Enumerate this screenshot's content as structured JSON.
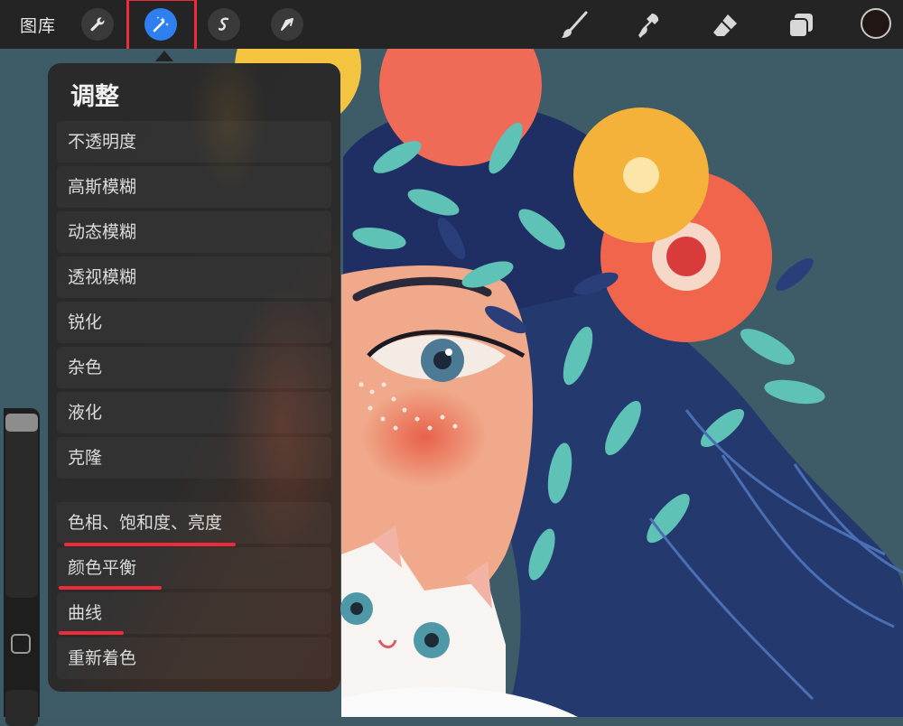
{
  "toolbar": {
    "gallery_label": "图库",
    "left_tools": [
      "wrench-icon",
      "magic-wand-icon",
      "selection-icon",
      "transform-arrow-icon"
    ],
    "right_tools": [
      "brush-icon",
      "smudge-icon",
      "eraser-icon",
      "layers-icon"
    ],
    "active_tool": "magic-wand-icon",
    "current_color": "#201715"
  },
  "adjustments": {
    "title": "调整",
    "items": [
      {
        "label": "不透明度",
        "highlighted": false
      },
      {
        "label": "高斯模糊",
        "highlighted": false
      },
      {
        "label": "动态模糊",
        "highlighted": false
      },
      {
        "label": "透视模糊",
        "highlighted": false
      },
      {
        "label": "锐化",
        "highlighted": false
      },
      {
        "label": "杂色",
        "highlighted": false
      },
      {
        "label": "液化",
        "highlighted": false
      },
      {
        "label": "克隆",
        "highlighted": false
      },
      {
        "label": "色相、饱和度、亮度",
        "highlighted": true
      },
      {
        "label": "颜色平衡",
        "highlighted": true
      },
      {
        "label": "曲线",
        "highlighted": true
      },
      {
        "label": "重新着色",
        "highlighted": false
      }
    ]
  },
  "annotation_color": "#ee2b3a",
  "accent_color": "#2f7ff0"
}
